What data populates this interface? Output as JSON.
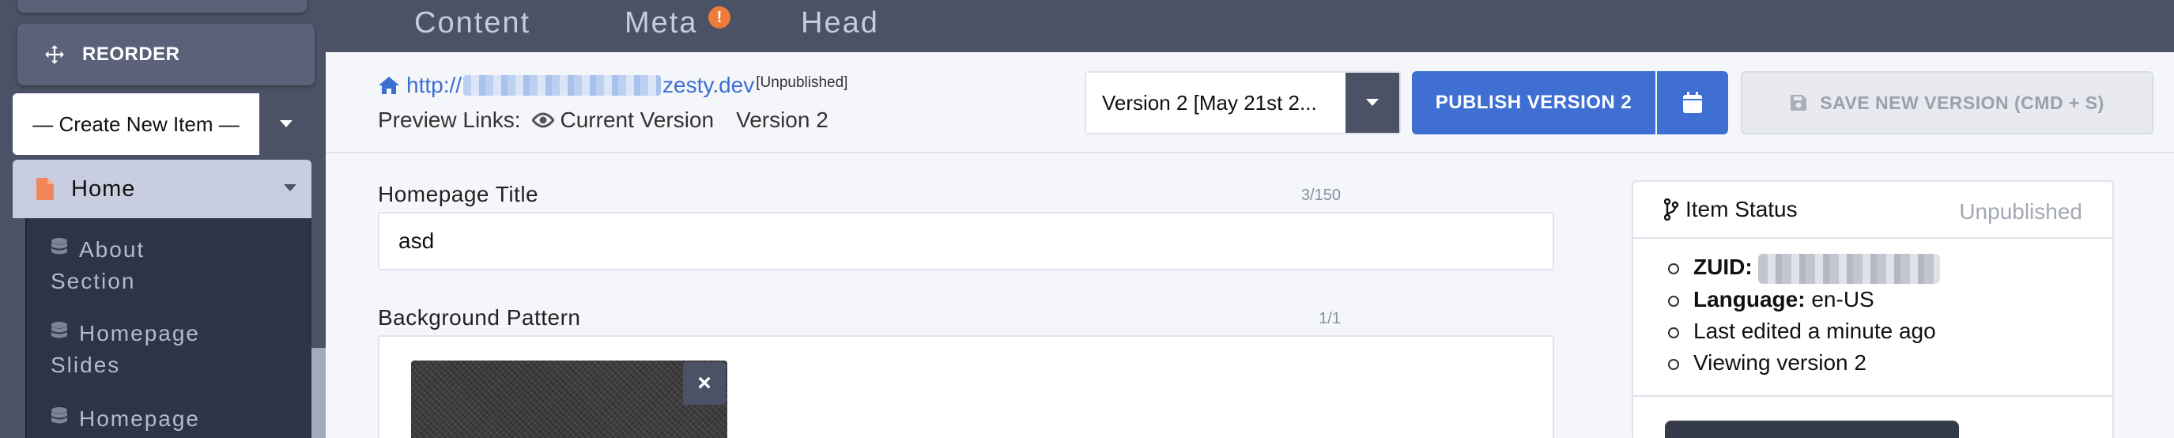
{
  "sidebar": {
    "reorder_label": "REORDER",
    "create_select": "— Create New Item —",
    "home_label": "Home",
    "items": [
      {
        "line1": "About",
        "line2": "Section"
      },
      {
        "line1": "Homepage",
        "line2": "Slides"
      },
      {
        "line1": "Homepage",
        "line2": ""
      }
    ]
  },
  "tabs": [
    {
      "label": "Content"
    },
    {
      "label": "Meta",
      "badge": "!"
    },
    {
      "label": "Head"
    }
  ],
  "header": {
    "url_prefix": "http://",
    "url_suffix": "zesty.dev",
    "url_status": "[Unpublished]",
    "preview_label": "Preview Links:",
    "preview_current": "Current Version",
    "preview_version": "Version 2",
    "version_select": "Version 2 [May 21st 2...",
    "publish_label": "PUBLISH VERSION 2",
    "save_label": "SAVE NEW VERSION (CMD + S)"
  },
  "fields": {
    "homepage_title": {
      "label": "Homepage Title",
      "count": "3/150",
      "value": "asd"
    },
    "background_pattern": {
      "label": "Background Pattern",
      "count": "1/1",
      "remove": "×"
    }
  },
  "status": {
    "title": "Item Status",
    "value": "Unpublished",
    "zuid_label": "ZUID:",
    "language_label": "Language:",
    "language_value": "en-US",
    "last_edited": "Last edited a minute ago",
    "viewing": "Viewing version 2"
  },
  "colors": {
    "accent": "#3f6fd3",
    "sidebar_bg": "#4b5266",
    "badge": "#f07a3a",
    "home_icon": "#f0875a"
  }
}
